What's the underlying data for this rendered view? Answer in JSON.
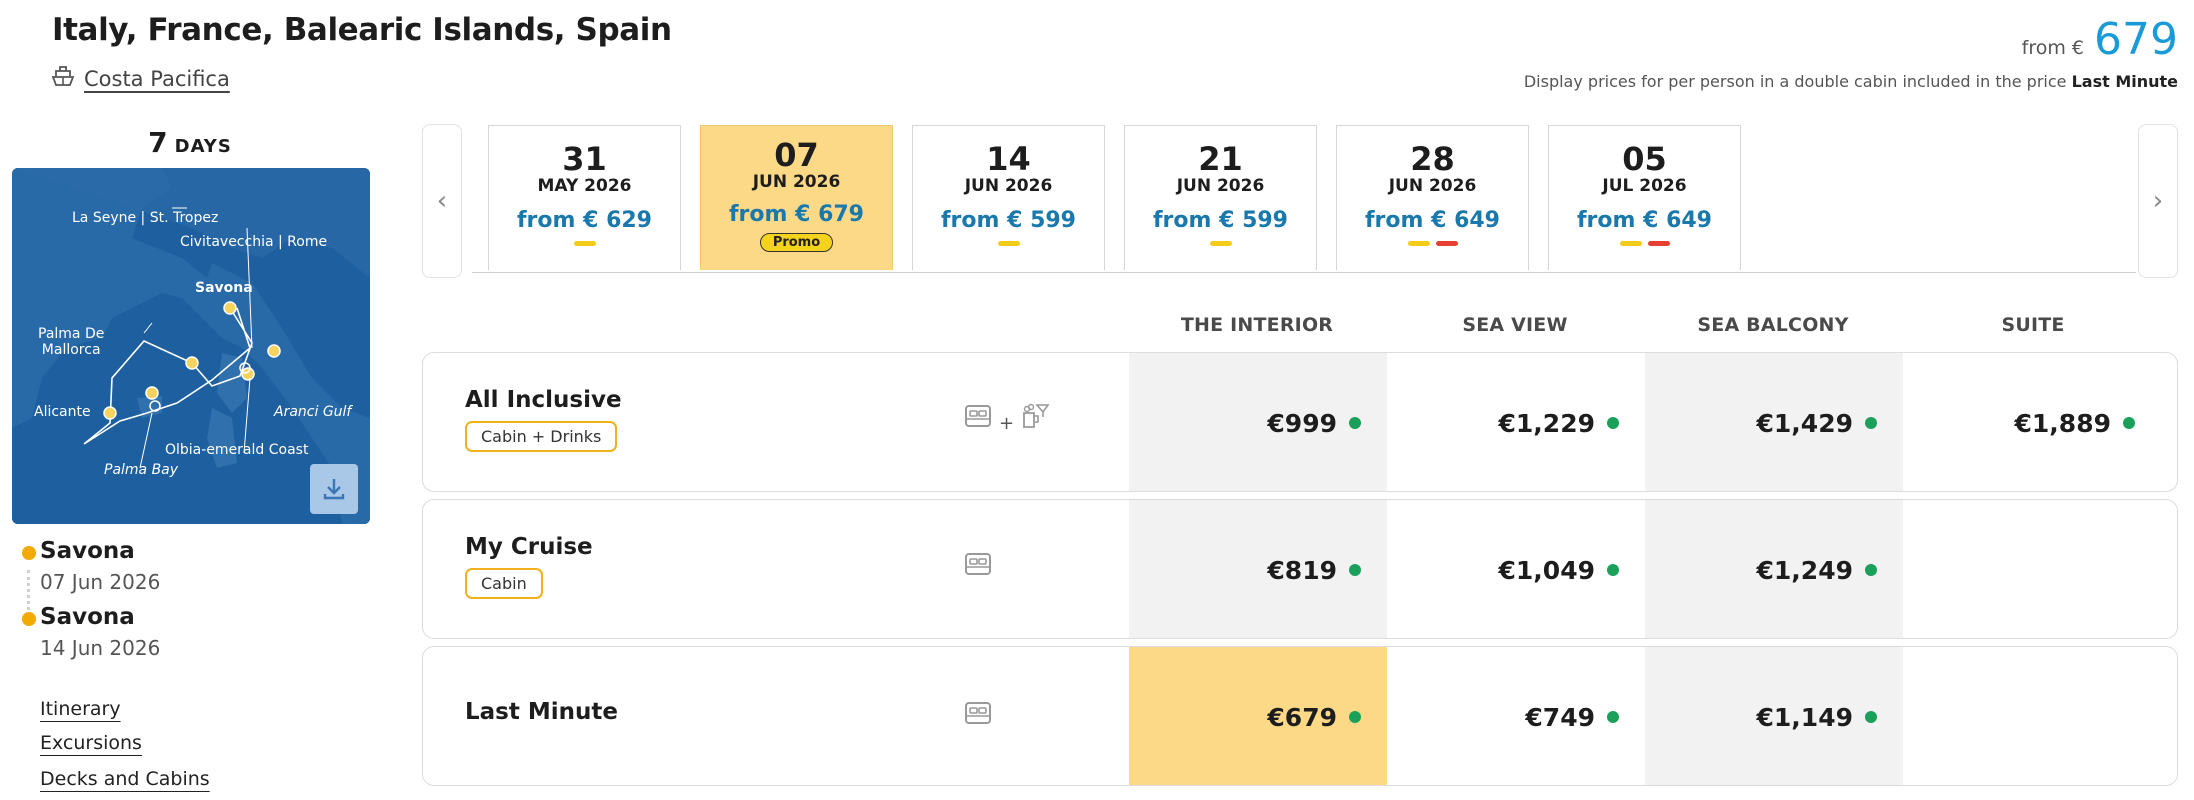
{
  "header": {
    "title": "Italy, France, Balearic Islands, Spain",
    "ship_name": "Costa Pacifica",
    "from_label": "from €",
    "from_price": "679",
    "display_note_prefix": "Display prices for per person in a double cabin included in the price",
    "display_note_bold": "Last Minute"
  },
  "left": {
    "days_num": "7",
    "days_label": "DAYS",
    "map_labels": {
      "la_seyne": "La Seyne | St. Tropez",
      "civitavecchia": "Civitavecchia | Rome",
      "savona": "Savona",
      "palma_de_mallorca": "Palma De\nMallorca",
      "alicante": "Alicante",
      "aranci": "Aranci Gulf",
      "olbia": "Olbia-emerald Coast",
      "palma_bay": "Palma Bay"
    },
    "departure": {
      "port": "Savona",
      "date": "07 Jun 2026"
    },
    "arrival": {
      "port": "Savona",
      "date": "14 Jun 2026"
    },
    "links": [
      "Itinerary",
      "Excursions",
      "Decks and Cabins"
    ]
  },
  "dates": [
    {
      "day": "31",
      "month": "MAY 2026",
      "price": "from € 629",
      "selected": false,
      "promo": "",
      "marks": [
        "y"
      ]
    },
    {
      "day": "07",
      "month": "JUN 2026",
      "price": "from € 679",
      "selected": true,
      "promo": "Promo",
      "marks": []
    },
    {
      "day": "14",
      "month": "JUN 2026",
      "price": "from € 599",
      "selected": false,
      "promo": "",
      "marks": [
        "y"
      ]
    },
    {
      "day": "21",
      "month": "JUN 2026",
      "price": "from € 599",
      "selected": false,
      "promo": "",
      "marks": [
        "y"
      ]
    },
    {
      "day": "28",
      "month": "JUN 2026",
      "price": "from € 649",
      "selected": false,
      "promo": "",
      "marks": [
        "y",
        "r"
      ]
    },
    {
      "day": "05",
      "month": "JUL 2026",
      "price": "from € 649",
      "selected": false,
      "promo": "",
      "marks": [
        "y",
        "r"
      ]
    }
  ],
  "cabin_types": [
    "THE INTERIOR",
    "SEA VIEW",
    "SEA BALCONY",
    "SUITE"
  ],
  "rates": [
    {
      "name": "All Inclusive",
      "tag": "Cabin + Drinks",
      "icons": "bed-plus-drinks",
      "prices": [
        "€999",
        "€1,229",
        "€1,429",
        "€1,889"
      ]
    },
    {
      "name": "My Cruise",
      "tag": "Cabin",
      "icons": "bed",
      "prices": [
        "€819",
        "€1,049",
        "€1,249",
        ""
      ]
    },
    {
      "name": "Last Minute",
      "tag": "",
      "icons": "bed",
      "prices": [
        "€679",
        "€749",
        "€1,149",
        ""
      ]
    }
  ],
  "colors": {
    "accent_blue": "#1a9ad6",
    "price_blue": "#1979ad",
    "selected_bg": "#fbd987",
    "promo_yellow": "#f5d21b",
    "tag_border": "#f2b11c",
    "available_green": "#1aa05a"
  },
  "icons": {
    "ship": "ship-icon",
    "download": "download-icon",
    "prev": "chevron-left-icon",
    "next": "chevron-right-icon",
    "bed": "bed-icon",
    "drinks": "drinks-icon"
  }
}
